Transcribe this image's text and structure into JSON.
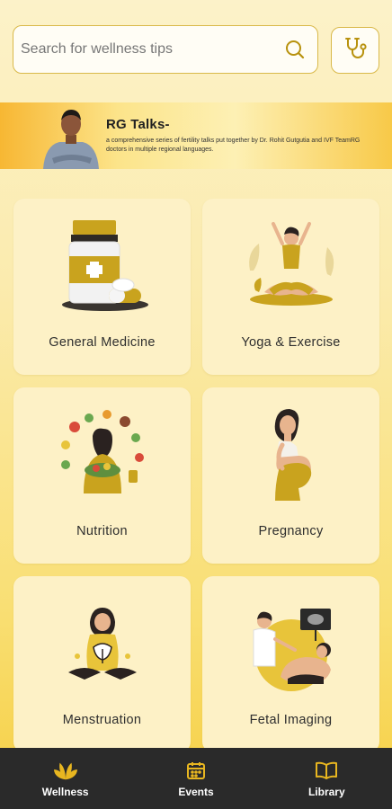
{
  "search": {
    "placeholder": "Search for wellness tips"
  },
  "banner": {
    "title": "RG Talks-",
    "subtitle": "a comprehensive series of fertility talks put together by Dr. Rohit Gutgutia and IVF TeamRG doctors in multiple regional languages."
  },
  "categories": [
    {
      "label": "General Medicine",
      "icon": "medicine-bottle-icon"
    },
    {
      "label": "Yoga & Exercise",
      "icon": "yoga-icon"
    },
    {
      "label": "Nutrition",
      "icon": "nutrition-icon"
    },
    {
      "label": "Pregnancy",
      "icon": "pregnancy-icon"
    },
    {
      "label": "Menstruation",
      "icon": "menstruation-icon"
    },
    {
      "label": "Fetal Imaging",
      "icon": "ultrasound-icon"
    }
  ],
  "nav": [
    {
      "label": "Wellness",
      "icon": "wellness-leaf-icon",
      "active": true
    },
    {
      "label": "Events",
      "icon": "calendar-icon",
      "active": false
    },
    {
      "label": "Library",
      "icon": "book-icon",
      "active": false
    }
  ],
  "colors": {
    "accent": "#D4A816",
    "nav_bg": "#2A2A2A",
    "card_bg": "#FDF1C6"
  }
}
